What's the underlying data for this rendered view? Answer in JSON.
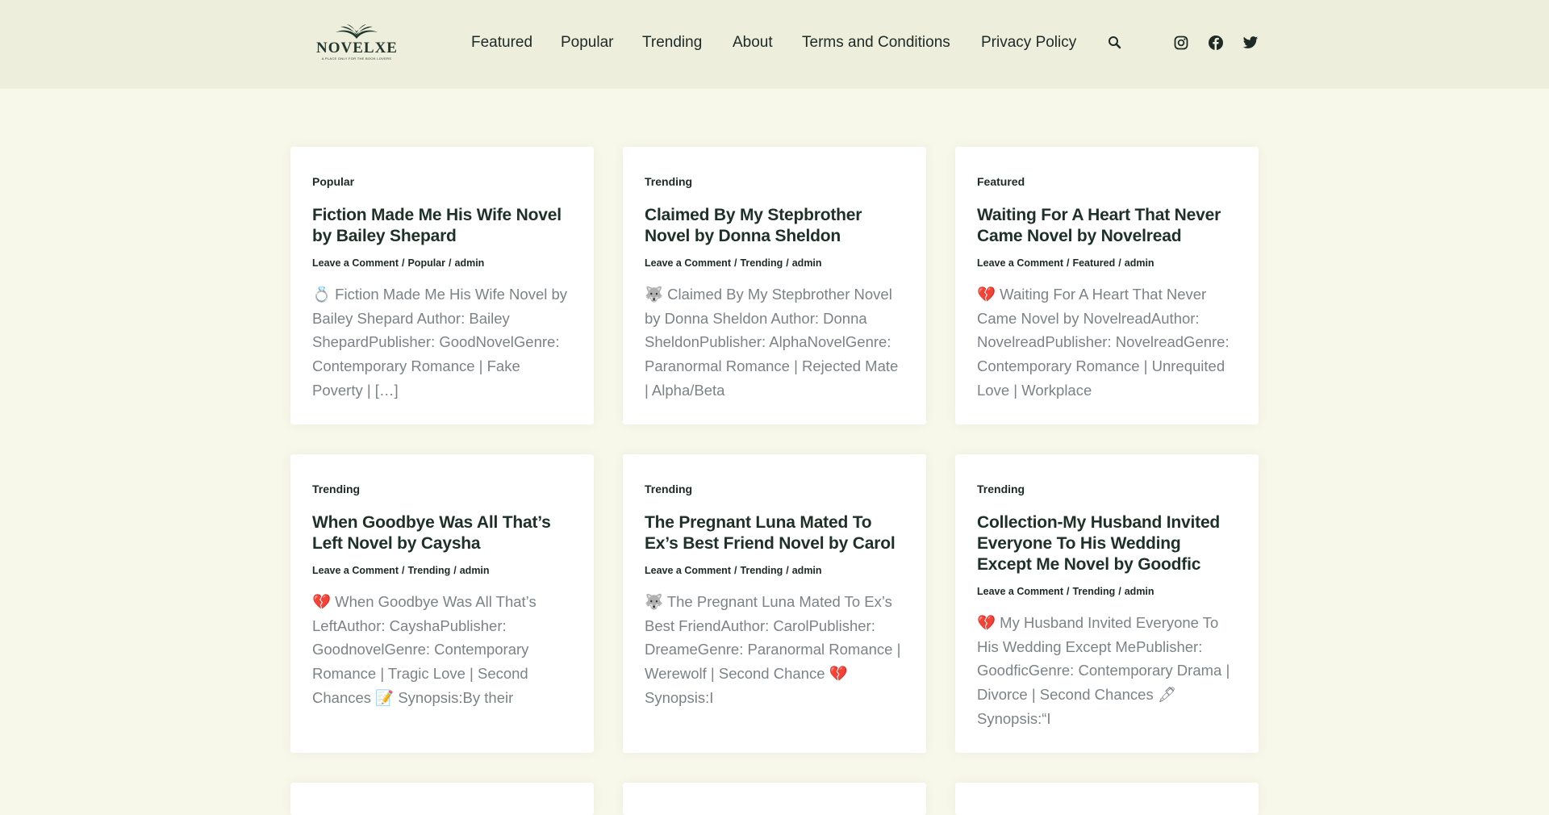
{
  "brand": {
    "name": "NOVELXE",
    "tagline": "A PLACE ONLY FOR THE BOOK LOVERS"
  },
  "nav": {
    "items": [
      "Featured",
      "Popular",
      "Trending",
      "About",
      "Terms and Conditions",
      "Privacy Policy"
    ]
  },
  "posts": [
    {
      "category": "Popular",
      "title": "Fiction Made Me His Wife Novel by Bailey Shepard",
      "meta": {
        "comment": "Leave a Comment",
        "category": "Popular",
        "author": "admin"
      },
      "excerpt": "💍 Fiction Made Me His Wife Novel by Bailey Shepard Author: Bailey ShepardPublisher: GoodNovelGenre: Contemporary Romance | Fake Poverty | […]"
    },
    {
      "category": "Trending",
      "title": "Claimed By My Stepbrother Novel by Donna Sheldon",
      "meta": {
        "comment": "Leave a Comment",
        "category": "Trending",
        "author": "admin"
      },
      "excerpt": "🐺 Claimed By My Stepbrother Novel by Donna Sheldon Author: Donna SheldonPublisher: AlphaNovelGenre: Paranormal Romance | Rejected Mate | Alpha/Beta"
    },
    {
      "category": "Featured",
      "title": "Waiting For A Heart That Never Came Novel by Novelread",
      "meta": {
        "comment": "Leave a Comment",
        "category": "Featured",
        "author": "admin"
      },
      "excerpt": "💔 Waiting For A Heart That Never Came Novel by NovelreadAuthor: NovelreadPublisher: NovelreadGenre: Contemporary Romance | Unrequited Love | Workplace"
    },
    {
      "category": "Trending",
      "title": "When Goodbye Was All That’s Left Novel by Caysha",
      "meta": {
        "comment": "Leave a Comment",
        "category": "Trending",
        "author": "admin"
      },
      "excerpt": "💔 When Goodbye Was All That’s LeftAuthor: CayshaPublisher: GoodnovelGenre: Contemporary Romance | Tragic Love | Second Chances 📝 Synopsis:By their"
    },
    {
      "category": "Trending",
      "title": "The Pregnant Luna Mated To Ex’s Best Friend Novel by Carol",
      "meta": {
        "comment": "Leave a Comment",
        "category": "Trending",
        "author": "admin"
      },
      "excerpt": "🐺 The Pregnant Luna Mated To Ex’s Best FriendAuthor: CarolPublisher: DreameGenre: Paranormal Romance | Werewolf | Second Chance 💔 Synopsis:I"
    },
    {
      "category": "Trending",
      "title": "Collection-My Husband Invited Everyone To His Wedding Except Me Novel by Goodfic",
      "meta": {
        "comment": "Leave a Comment",
        "category": "Trending",
        "author": "admin"
      },
      "excerpt": "💔 My Husband Invited Everyone To His Wedding Except MePublisher: GoodficGenre: Contemporary Drama | Divorce | Second Chances 🖋 Synopsis:“I"
    }
  ],
  "icons": [
    "search-icon",
    "instagram-icon",
    "facebook-icon",
    "twitter-icon"
  ]
}
